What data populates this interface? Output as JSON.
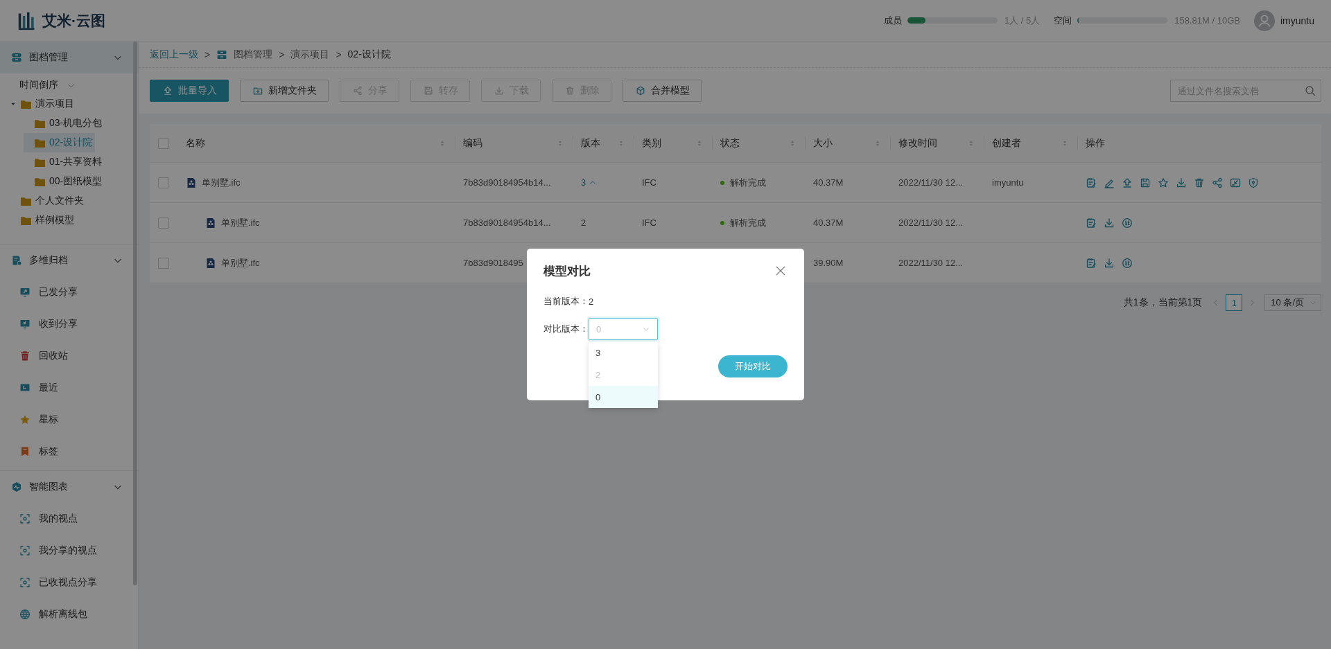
{
  "header": {
    "logo_text": "艾米·云图",
    "quotas": [
      {
        "label": "成员",
        "level": 0.2,
        "reading": "1人 / 5人"
      },
      {
        "label": "空间",
        "level": 0.015,
        "reading": "158.81M / 10GB"
      }
    ],
    "user": {
      "name": "imyuntu"
    }
  },
  "sidebar": {
    "sections": [
      {
        "title": "图档管理",
        "kind": "drawer",
        "expanded": true,
        "selected": true,
        "sort": {
          "label": "时间倒序"
        },
        "tree": [
          {
            "label": "演示项目",
            "expanded": true,
            "selected": false,
            "children": [
              {
                "label": "03-机电分包",
                "selected": false
              },
              {
                "label": "02-设计院",
                "selected": true
              },
              {
                "label": "01-共享资料",
                "selected": false
              },
              {
                "label": "00-图纸模型",
                "selected": false
              }
            ]
          },
          {
            "label": "个人文件夹",
            "selected": false
          },
          {
            "label": "样例模型",
            "selected": false
          }
        ]
      },
      {
        "title": "多维归档",
        "kind": "archive",
        "expanded": true,
        "selected": false,
        "items": [
          {
            "label": "已发分享",
            "kind": "sent"
          },
          {
            "label": "收到分享",
            "kind": "received"
          },
          {
            "label": "回收站",
            "kind": "recycle"
          },
          {
            "label": "最近",
            "kind": "recent"
          },
          {
            "label": "星标",
            "kind": "star"
          },
          {
            "label": "标签",
            "kind": "tag"
          }
        ]
      },
      {
        "title": "智能图表",
        "kind": "chart",
        "expanded": true,
        "selected": false,
        "items": [
          {
            "label": "我的视点",
            "kind": "view"
          },
          {
            "label": "我分享的视点",
            "kind": "view"
          },
          {
            "label": "已收视点分享",
            "kind": "view"
          },
          {
            "label": "解析离线包",
            "kind": "globe"
          }
        ]
      }
    ]
  },
  "breadcrumb": {
    "back": "返回上一级",
    "items": [
      {
        "separator": ">",
        "label": "图档管理",
        "kind": "drawer",
        "current": false
      },
      {
        "separator": ">",
        "label": "演示项目",
        "current": false
      },
      {
        "separator": ">",
        "label": "02-设计院",
        "current": true
      }
    ]
  },
  "toolbar": {
    "buttons": [
      {
        "label": "批量导入",
        "kind": "upload",
        "primary": true,
        "disabled": false
      },
      {
        "label": "新增文件夹",
        "kind": "folder-add",
        "primary": false,
        "disabled": false
      },
      {
        "label": "分享",
        "kind": "share",
        "primary": false,
        "disabled": true
      },
      {
        "label": "转存",
        "kind": "save",
        "primary": false,
        "disabled": true
      },
      {
        "label": "下载",
        "kind": "download",
        "primary": false,
        "disabled": true
      },
      {
        "label": "删除",
        "kind": "trash",
        "primary": false,
        "disabled": true
      },
      {
        "label": "合并模型",
        "kind": "cube",
        "primary": false,
        "disabled": false
      }
    ],
    "search": {
      "placeholder": "通过文件名搜索文档"
    }
  },
  "table": {
    "checked": false,
    "columns": [
      {
        "label": "名称",
        "sortable": true
      },
      {
        "label": "编码",
        "sortable": true
      },
      {
        "label": "版本",
        "sortable": true
      },
      {
        "label": "类别",
        "sortable": true
      },
      {
        "label": "状态",
        "sortable": true
      },
      {
        "label": "大小",
        "sortable": true
      },
      {
        "label": "修改时间",
        "sortable": true
      },
      {
        "label": "创建者",
        "sortable": true
      },
      {
        "label": "操作",
        "sortable": false
      }
    ],
    "rows": [
      {
        "checked": false,
        "name": "单别墅.ifc",
        "code": "7b83d90184954b14...",
        "version": "3",
        "expanded": true,
        "type": "IFC",
        "status": {
          "label": "解析完成"
        },
        "size": "40.37M",
        "modified": "2022/11/30 12...",
        "creator": "imyuntu",
        "actions": [
          {
            "kind": "notes"
          },
          {
            "kind": "edit"
          },
          {
            "kind": "upload"
          },
          {
            "kind": "save"
          },
          {
            "kind": "star"
          },
          {
            "kind": "download"
          },
          {
            "kind": "trash"
          },
          {
            "kind": "share"
          },
          {
            "kind": "screen"
          },
          {
            "kind": "shield"
          }
        ],
        "children": [
          {
            "checked": false,
            "name": "单别墅.ifc",
            "code": "7b83d90184954b14...",
            "version": "2",
            "type": "IFC",
            "status": {
              "label": "解析完成"
            },
            "size": "40.37M",
            "modified": "2022/11/30 12...",
            "actions": [
              {
                "kind": "notes"
              },
              {
                "kind": "download"
              },
              {
                "kind": "compare"
              }
            ]
          },
          {
            "checked": false,
            "name": "单别墅.ifc",
            "code": "7b83d9018495",
            "size": "39.90M",
            "modified": "2022/11/30 12...",
            "actions": [
              {
                "kind": "notes"
              },
              {
                "kind": "download"
              },
              {
                "kind": "compare"
              }
            ]
          }
        ]
      }
    ]
  },
  "pagination": {
    "summary": "共1条，当前第1页",
    "pages": [
      {
        "label": "1",
        "selected": true
      }
    ],
    "page_size": "10 条/页"
  },
  "dialog": {
    "title": "模型对比",
    "fields": [
      {
        "kind": "text",
        "label": "当前版本：",
        "value": "2"
      },
      {
        "kind": "select",
        "label": "对比版本：",
        "value": "0",
        "open": true,
        "options": [
          {
            "label": "3",
            "disabled": false,
            "selected": false
          },
          {
            "label": "2",
            "disabled": true,
            "selected": false
          },
          {
            "label": "0",
            "disabled": false,
            "selected": true
          }
        ]
      }
    ],
    "button": "开始对比"
  }
}
